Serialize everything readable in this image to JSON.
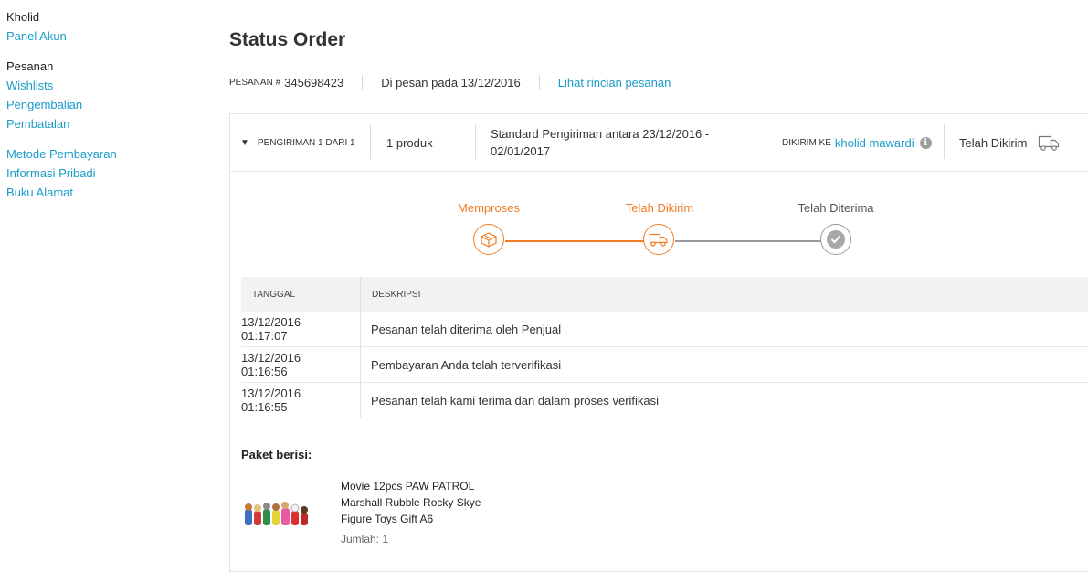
{
  "sidebar": {
    "user_name": "Kholid",
    "panel_akun": "Panel Akun",
    "section_orders": "Pesanan",
    "wishlists": "Wishlists",
    "pengembalian": "Pengembalian",
    "pembatalan": "Pembatalan",
    "metode_pembayaran": "Metode Pembayaran",
    "informasi_pribadi": "Informasi Pribadi",
    "buku_alamat": "Buku Alamat"
  },
  "order": {
    "title": "Status Order",
    "order_label": "PESANAN #",
    "order_number": "345698423",
    "ordered_on": "Di pesan pada 13/12/2016",
    "detail_link": "Lihat rincian pesanan"
  },
  "shipment": {
    "label": "PENGIRIMAN 1 DARI 1",
    "products": "1 produk",
    "delivery_line1": "Standard Pengiriman antara 23/12/2016 -",
    "delivery_line2": "02/01/2017",
    "ship_to_label": "DIKIRIM KE",
    "ship_to_name": "kholid mawardi",
    "status": "Telah Dikirim"
  },
  "progress": {
    "steps": [
      {
        "label": "Memproses",
        "icon": "box-icon",
        "state": "done"
      },
      {
        "label": "Telah Dikirim",
        "icon": "truck-icon",
        "state": "current"
      },
      {
        "label": "Telah Diterima",
        "icon": "check-icon",
        "state": "pending"
      }
    ],
    "active_color": "#f27c24",
    "pending_color": "#9a9a9a"
  },
  "history": {
    "col_date": "TANGGAL",
    "col_desc": "DESKRIPSI",
    "rows": [
      {
        "date": "13/12/2016 01:17:07",
        "desc": "Pesanan telah diterima oleh Penjual"
      },
      {
        "date": "13/12/2016 01:16:56",
        "desc": "Pembayaran Anda telah terverifikasi"
      },
      {
        "date": "13/12/2016 01:16:55",
        "desc": "Pesanan telah kami terima dan dalam proses verifikasi"
      }
    ]
  },
  "package": {
    "heading": "Paket berisi:",
    "product_line1": "Movie 12pcs PAW PATROL",
    "product_line2": "Marshall Rubble Rocky Skye",
    "product_line3": "Figure Toys Gift A6",
    "quantity": "Jumlah: 1"
  },
  "colors": {
    "link": "#1a9cc9",
    "accent": "#f27c24"
  }
}
